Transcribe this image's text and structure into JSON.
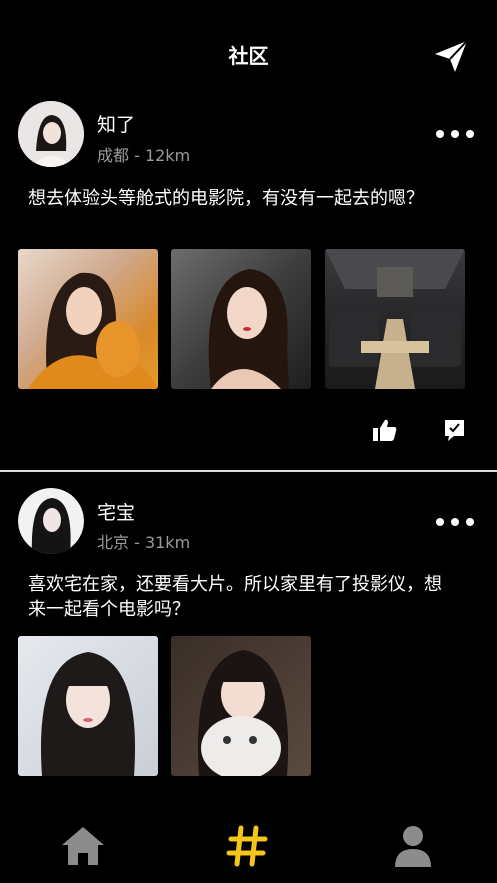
{
  "header": {
    "title": "社区"
  },
  "posts": [
    {
      "username": "知了",
      "meta": "成都 - 12km",
      "content": "想去体验头等舱式的电影院，有没有一起去的嗯？"
    },
    {
      "username": "宅宝",
      "meta": "北京 - 31km",
      "content": "喜欢宅在家，还要看大片。所以家里有了投影仪，想来一起看个电影吗？"
    }
  ],
  "tabbar": {
    "items": [
      {
        "icon": "home-icon",
        "active": false
      },
      {
        "icon": "hashtag-icon",
        "active": true
      },
      {
        "icon": "profile-icon",
        "active": false
      }
    ],
    "active_color": "#f5c518",
    "inactive_color": "#8c8c8c"
  }
}
